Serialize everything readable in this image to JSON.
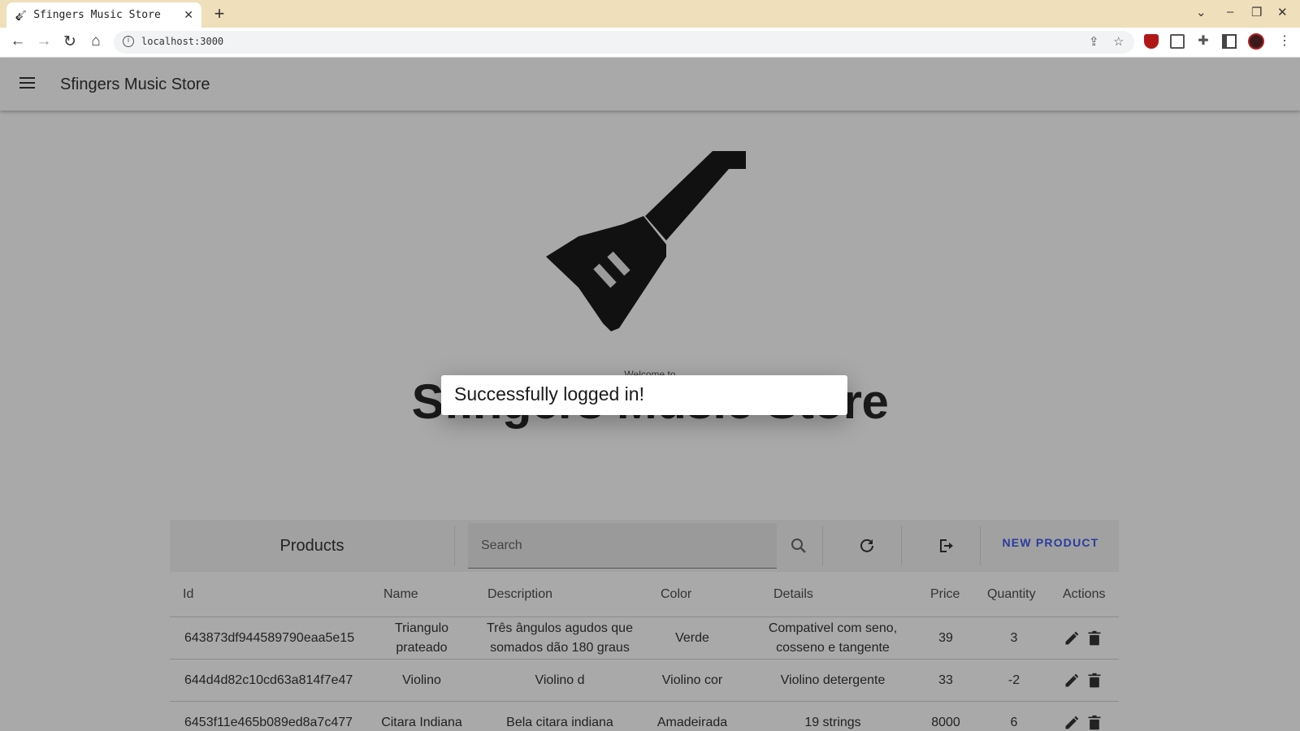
{
  "browser": {
    "tab_title": "Sfingers Music Store",
    "url": "localhost:3000"
  },
  "app": {
    "title": "Sfingers Music Store"
  },
  "hero": {
    "welcome": "Welcome to",
    "title": "Sfingers Music Store"
  },
  "toast": {
    "message": "Successfully logged in!"
  },
  "products": {
    "title": "Products",
    "search_placeholder": "Search",
    "new_product_label": "NEW PRODUCT",
    "columns": {
      "id": "Id",
      "name": "Name",
      "description": "Description",
      "color": "Color",
      "details": "Details",
      "price": "Price",
      "quantity": "Quantity",
      "actions": "Actions"
    },
    "rows": [
      {
        "id": "643873df944589790eaa5e15",
        "name": "Triangulo prateado",
        "description": "Três ângulos agudos que somados dão 180 graus",
        "color": "Verde",
        "details": "Compativel com seno, cosseno e tangente",
        "price": "39",
        "quantity": "3"
      },
      {
        "id": "644d4d82c10cd63a814f7e47",
        "name": "Violino",
        "description": "Violino d",
        "color": "Violino cor",
        "details": "Violino detergente",
        "price": "33",
        "quantity": "-2"
      },
      {
        "id": "6453f11e465b089ed8a7c477",
        "name": "Citara Indiana",
        "description": "Bela citara indiana",
        "color": "Amadeirada",
        "details": "19 strings",
        "price": "8000",
        "quantity": "6"
      }
    ]
  },
  "colors": {
    "accent": "#2a3ca0",
    "tabbar": "#efdfbb",
    "overlay_bg": "#a9a9a9"
  }
}
